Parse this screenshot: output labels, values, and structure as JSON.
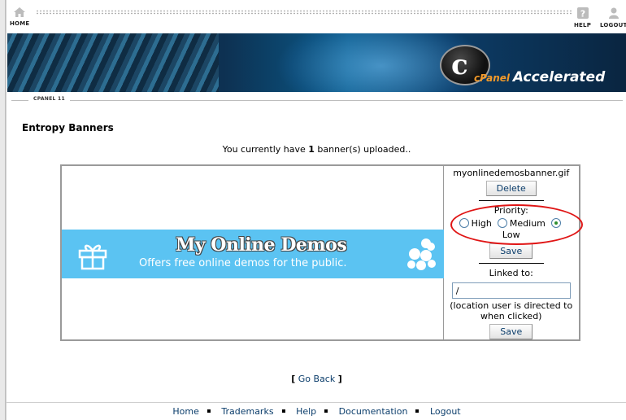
{
  "topbar": {
    "home_label": "HOME",
    "help_label": "HELP",
    "logout_label": "LOGOUT"
  },
  "brand": {
    "cpanel": "cPanel",
    "accelerated": "Accelerated"
  },
  "breadcrumb": "CPANEL 11",
  "page": {
    "title": "Entropy Banners",
    "count_prefix": "You currently have ",
    "count_value": "1",
    "count_suffix": " banner(s) uploaded.."
  },
  "banner": {
    "image_title": "My Online Demos",
    "image_subtitle": "Offers free online demos for the public.",
    "filename": "myonlinedemosbanner.gif",
    "delete_label": "Delete",
    "priority_label": "Priority:",
    "priority_options": [
      "High",
      "Medium",
      "Low"
    ],
    "priority_selected": "Low",
    "save_label": "Save",
    "linked_label": "Linked to:",
    "linked_value": "/",
    "linked_hint": "(location user is directed to when clicked)",
    "save2_label": "Save"
  },
  "nav": {
    "go_back": "Go Back"
  },
  "footer": {
    "links": [
      "Home",
      "Trademarks",
      "Help",
      "Documentation",
      "Logout"
    ]
  },
  "colors": {
    "link": "#0b3d6b",
    "banner_bg": "#5bc3f2",
    "highlight_ring": "#e01515",
    "radio_selected": "#2f8f2f"
  }
}
